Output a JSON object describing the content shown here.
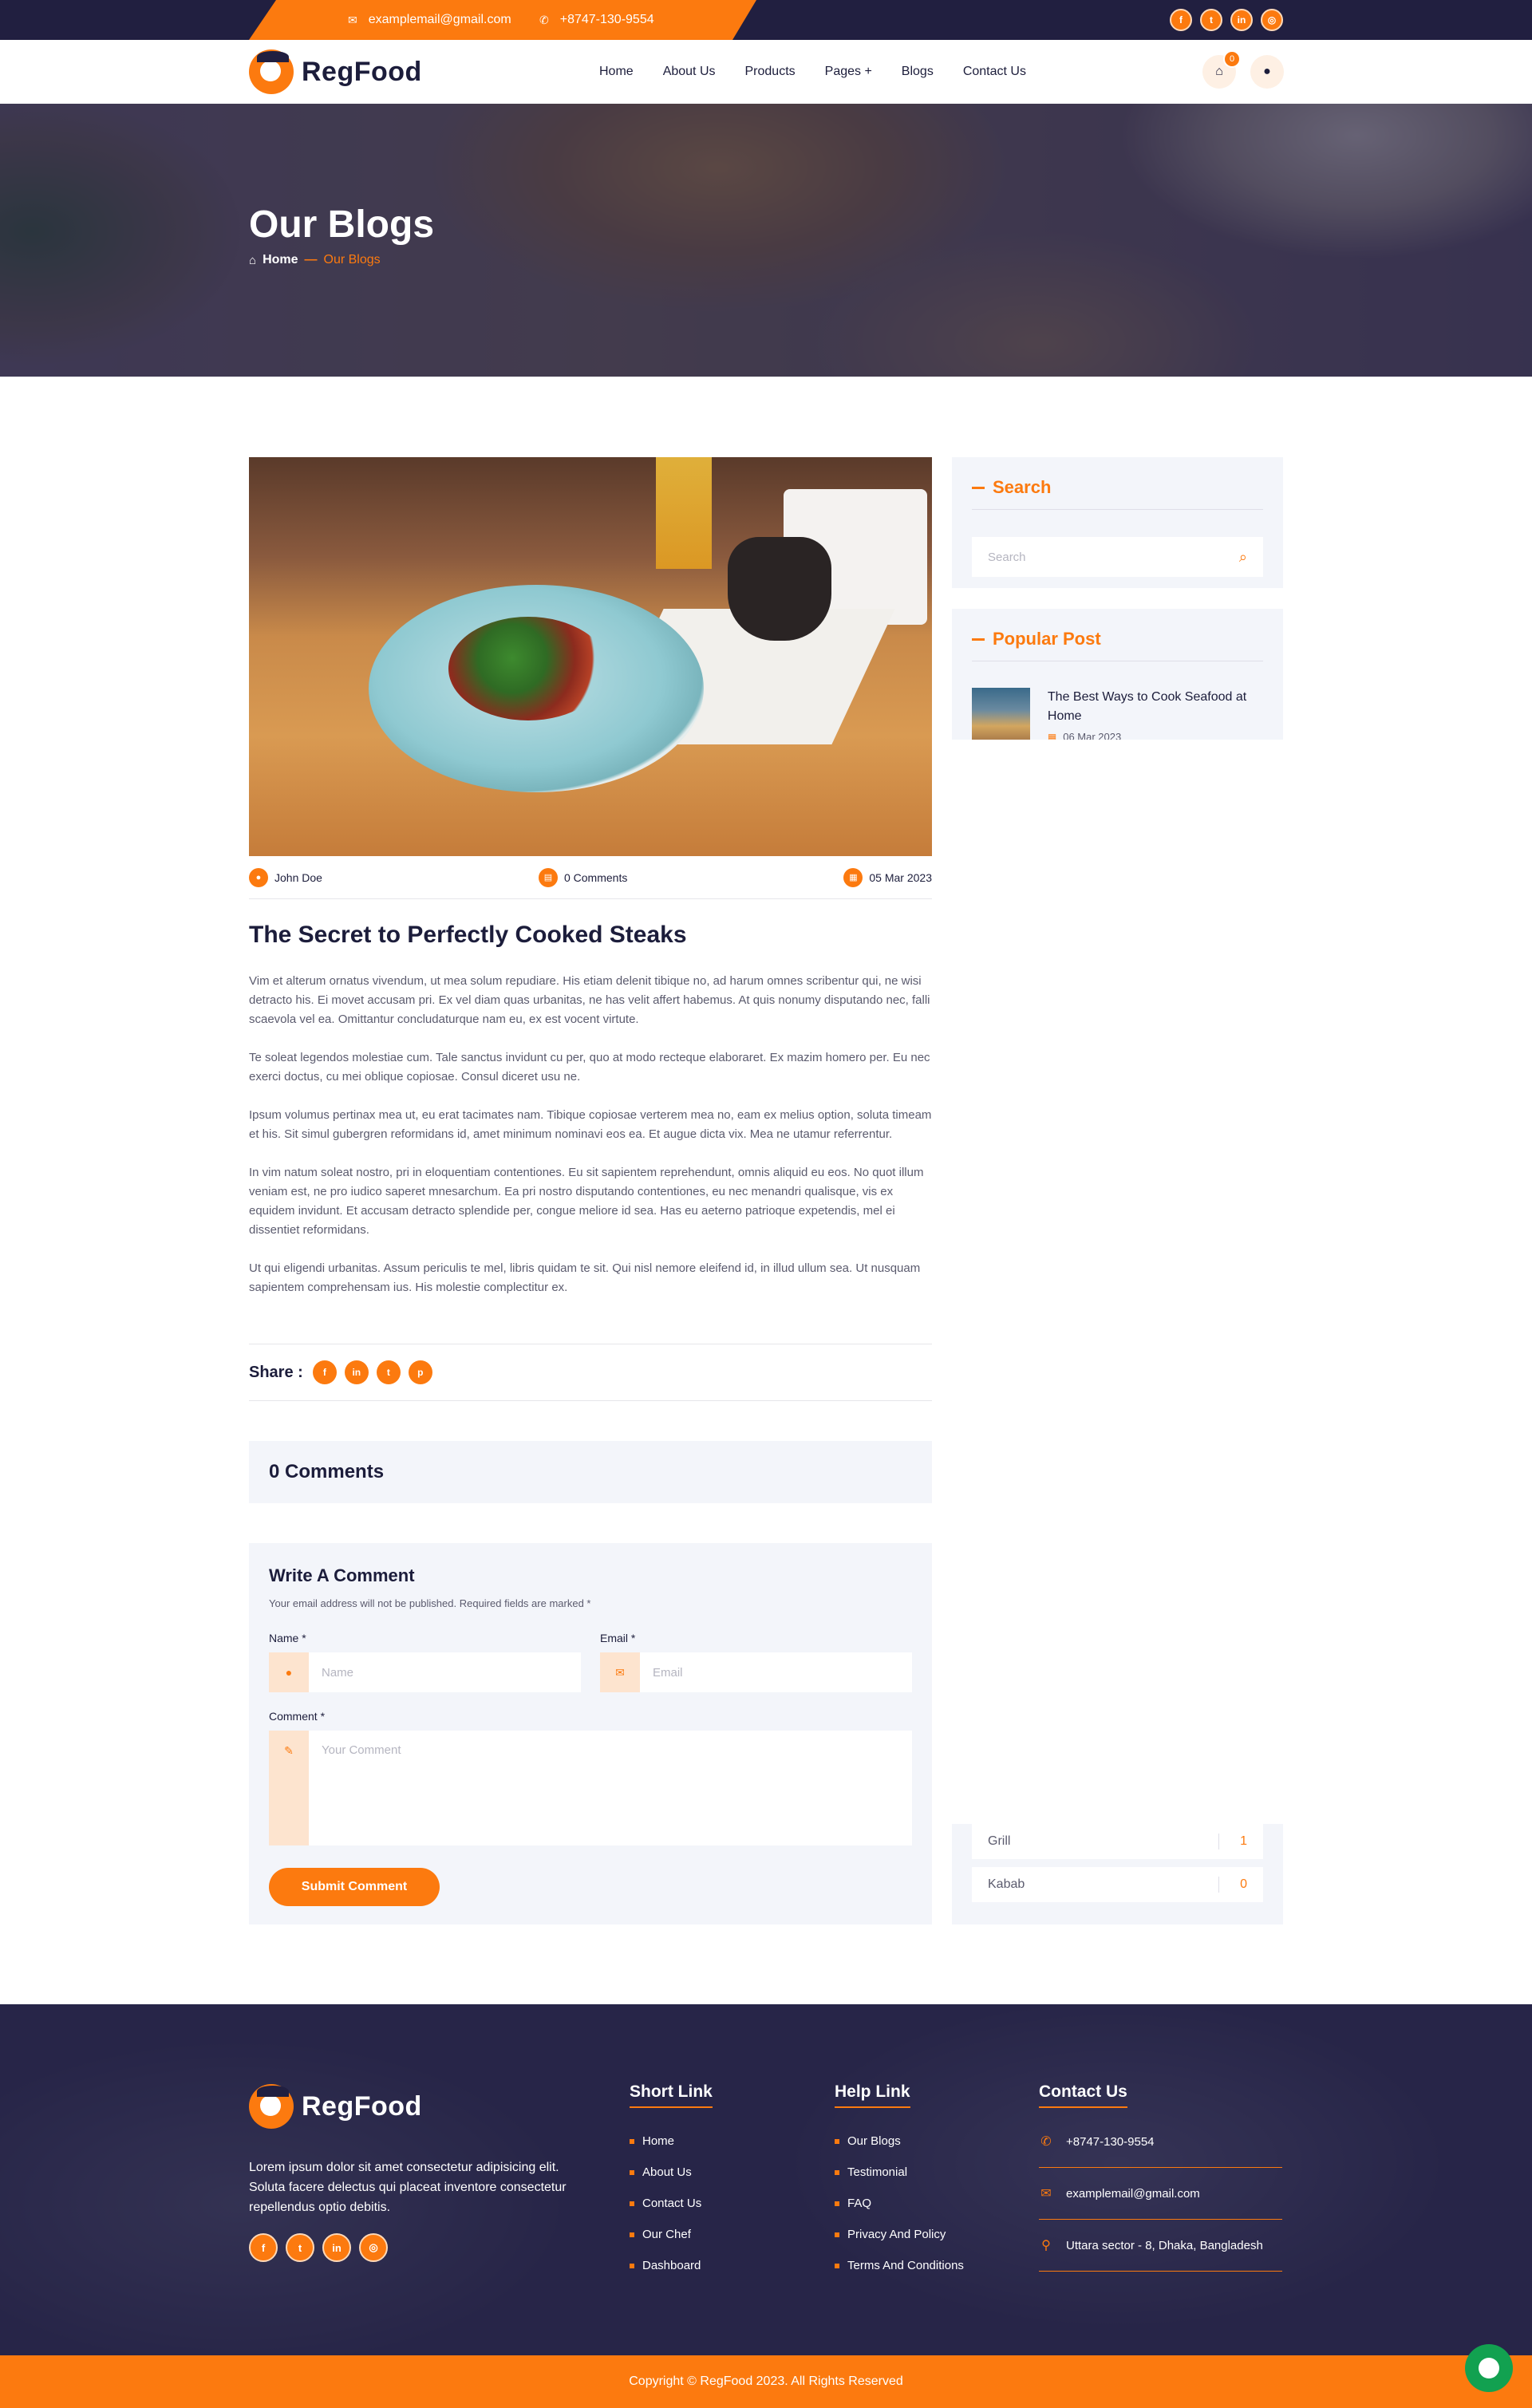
{
  "colors": {
    "accent": "#fc7a0f",
    "dark": "#211f40",
    "panel": "#f3f5fa"
  },
  "topbar": {
    "email": "examplemail@gmail.com",
    "phone": "+8747-130-9554",
    "social": [
      {
        "icon": "facebook-icon",
        "glyph": "f"
      },
      {
        "icon": "twitter-icon",
        "glyph": "t"
      },
      {
        "icon": "linkedin-icon",
        "glyph": "in"
      },
      {
        "icon": "instagram-icon",
        "glyph": "◎"
      }
    ]
  },
  "nav": {
    "brand": "RegFood",
    "items": [
      "Home",
      "About Us",
      "Products",
      "Pages +",
      "Blogs",
      "Contact Us"
    ],
    "cart_count": "0"
  },
  "hero": {
    "title": "Our Blogs",
    "breadcrumb_home": "Home",
    "breadcrumb_sep": "—",
    "breadcrumb_current": "Our Blogs"
  },
  "post": {
    "author": "John Doe",
    "comments": "0 Comments",
    "date": "05 Mar 2023",
    "title": "The Secret to Perfectly Cooked Steaks",
    "paragraphs": [
      "Vim et alterum ornatus vivendum, ut mea solum repudiare. His etiam delenit tibique no, ad harum omnes scribentur qui, ne wisi detracto his. Ei movet accusam pri. Ex vel diam quas urbanitas, ne has velit affert habemus. At quis nonumy disputando nec, falli scaevola vel ea. Omittantur concludaturque nam eu, ex est vocent virtute.",
      "Te soleat legendos molestiae cum. Tale sanctus invidunt cu per, quo at modo recteque elaboraret. Ex mazim homero per. Eu nec exerci doctus, cu mei oblique copiosae. Consul diceret usu ne.",
      "Ipsum volumus pertinax mea ut, eu erat tacimates nam. Tibique copiosae verterem mea no, eam ex melius option, soluta timeam et his. Sit simul gubergren reformidans id, amet minimum nominavi eos ea. Et augue dicta vix. Mea ne utamur referrentur.",
      "In vim natum soleat nostro, pri in eloquentiam contentiones. Eu sit sapientem reprehendunt, omnis aliquid eu eos. No quot illum veniam est, ne pro iudico saperet mnesarchum. Ea pri nostro disputando contentiones, eu nec menandri qualisque, vis ex equidem invidunt. Et accusam detracto splendide per, congue meliore id sea. Has eu aeterno patrioque expetendis, mel ei dissentiet reformidans.",
      "Ut qui eligendi urbanitas. Assum periculis te mel, libris quidam te sit. Qui nisl nemore eleifend id, in illud ullum sea. Ut nusquam sapientem comprehensam ius. His molestie complectitur ex."
    ],
    "share_label": "Share :",
    "share_icons": [
      {
        "icon": "facebook-icon",
        "glyph": "f"
      },
      {
        "icon": "linkedin-icon",
        "glyph": "in"
      },
      {
        "icon": "twitter-icon",
        "glyph": "t"
      },
      {
        "icon": "pinterest-icon",
        "glyph": "p"
      }
    ]
  },
  "comments_section": {
    "title": "0 Comments"
  },
  "comment_form": {
    "title": "Write A Comment",
    "note": "Your email address will not be published. Required fields are marked *",
    "name_label": "Name *",
    "name_placeholder": "Name",
    "email_label": "Email *",
    "email_placeholder": "Email",
    "comment_label": "Comment *",
    "comment_placeholder": "Your Comment",
    "submit": "Submit Comment"
  },
  "sidebar": {
    "search_title": "Search",
    "search_placeholder": "Search",
    "popular_title": "Popular Post",
    "popular_posts": [
      {
        "title": "The Best Ways to Cook Seafood at Home",
        "date": "06 Mar 2023"
      }
    ],
    "categories": [
      {
        "name": "Grill",
        "count": "1"
      },
      {
        "name": "Kabab",
        "count": "0"
      }
    ]
  },
  "footer": {
    "brand": "RegFood",
    "about": "Lorem ipsum dolor sit amet consectetur adipisicing elit. Soluta facere delectus qui placeat inventore consectetur repellendus optio debitis.",
    "short_link_title": "Short Link",
    "short_links": [
      "Home",
      "About Us",
      "Contact Us",
      "Our Chef",
      "Dashboard"
    ],
    "help_link_title": "Help Link",
    "help_links": [
      "Our Blogs",
      "Testimonial",
      "FAQ",
      "Privacy And Policy",
      "Terms And Conditions"
    ],
    "contact_title": "Contact Us",
    "contact_phone": "+8747-130-9554",
    "contact_email": "examplemail@gmail.com",
    "contact_address": "Uttara sector - 8, Dhaka, Bangladesh",
    "copyright": "Copyright © RegFood 2023. All Rights Reserved"
  }
}
